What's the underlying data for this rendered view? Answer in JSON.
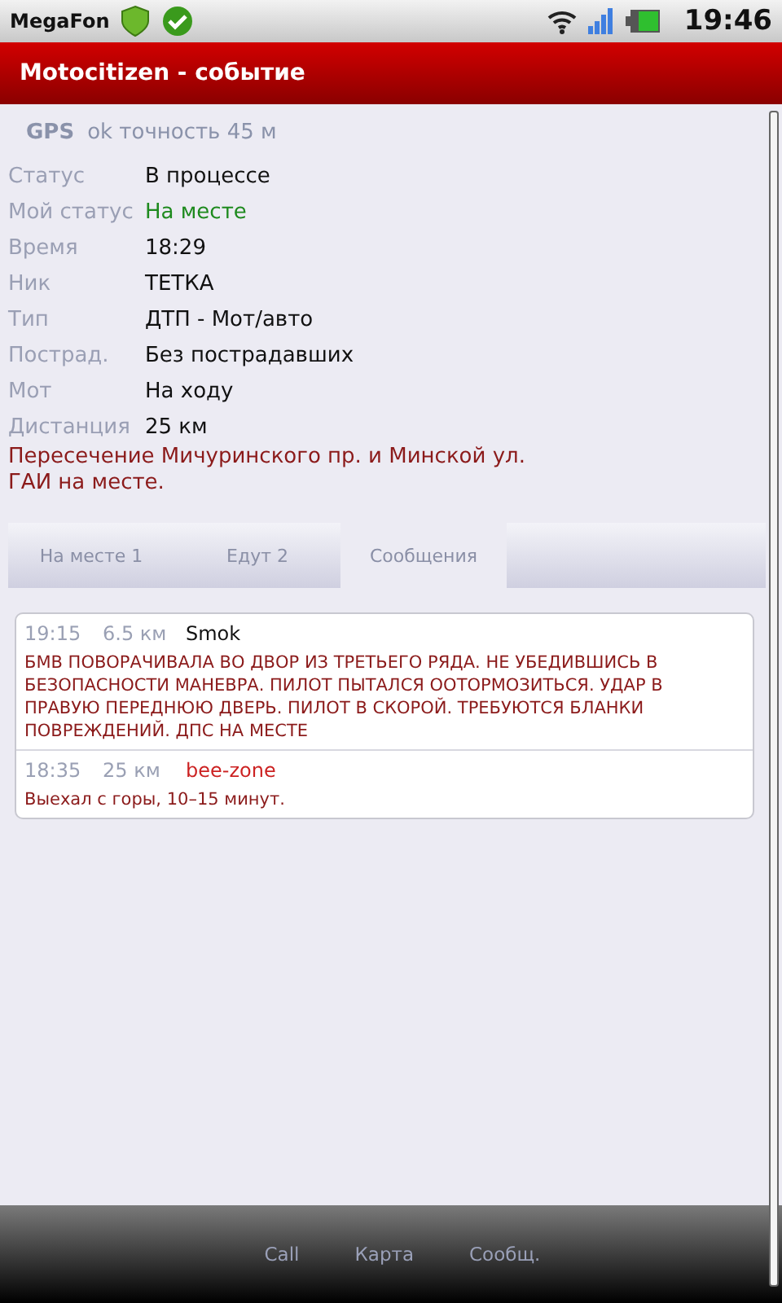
{
  "status_bar": {
    "carrier": "MegaFon",
    "time": "19:46"
  },
  "title": "Motocitizen - событие",
  "gps": {
    "label": "GPS",
    "text": "ok точность 45 м"
  },
  "fields": [
    {
      "label": "Статус",
      "value": "В процессе",
      "color": "#111111"
    },
    {
      "label": "Мой статус",
      "value": "На месте",
      "color": "#1e8a1e"
    },
    {
      "label": "Время",
      "value": "18:29",
      "color": "#111111"
    },
    {
      "label": "Ник",
      "value": "ТЕТКА",
      "color": "#111111"
    },
    {
      "label": "Тип",
      "value": "ДТП - Мот/авто",
      "color": "#111111"
    },
    {
      "label": "Пострад.",
      "value": "Без пострадавших",
      "color": "#111111"
    },
    {
      "label": "Мот",
      "value": "На ходу",
      "color": "#111111"
    },
    {
      "label": "Дистанция",
      "value": "25 км",
      "color": "#111111"
    }
  ],
  "address": [
    "Пересечение Мичуринского пр. и Минской ул.",
    "ГАИ на месте."
  ],
  "tabs": [
    {
      "label": "На месте 1",
      "selected": false
    },
    {
      "label": "Едут 2",
      "selected": false
    },
    {
      "label": "Сообщения",
      "selected": true
    }
  ],
  "messages": [
    {
      "time": "19:15",
      "distance": "6.5 км",
      "author": "Smok",
      "color": "#111111",
      "text": "БМВ ПОВОРАЧИВАЛА ВО ДВОР ИЗ ТРЕТЬЕГО РЯДА. НЕ УБЕДИВШИСЬ В БЕЗОПАСНОСТИ МАНЕВРА. ПИЛОТ ПЫТАЛСЯ ООТОРМОЗИТЬСЯ. УДАР В ПРАВУЮ ПЕРЕДНЮЮ ДВЕРЬ. ПИЛОТ В СКОРОЙ. ТРЕБУЮТСЯ БЛАНКИ ПОВРЕЖДЕНИЙ. ДПС НА МЕСТЕ"
    },
    {
      "time": "18:35",
      "distance": "25 км",
      "author": "bee-zone",
      "color": "#cc2222",
      "text": "Выехал с горы, 10–15 минут."
    }
  ],
  "bottom_buttons": [
    "Call",
    "Карта",
    "Сообщ."
  ]
}
